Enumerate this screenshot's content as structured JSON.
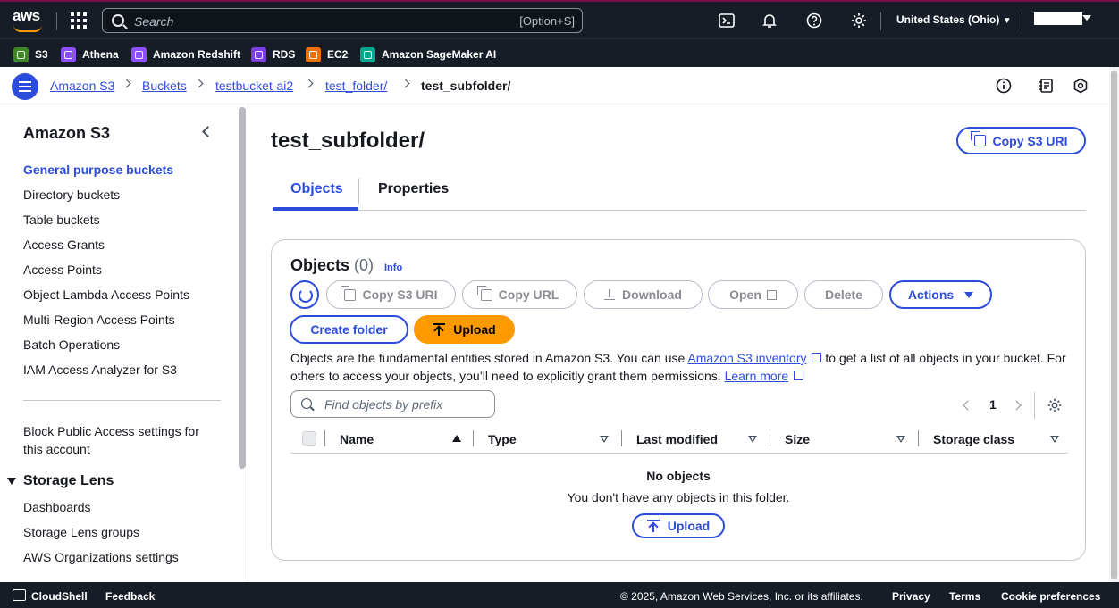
{
  "topnav": {
    "logo": "aws",
    "search_placeholder": "Search",
    "search_shortcut": "[Option+S]",
    "region": "United States (Ohio)",
    "icons": [
      "grid-icon",
      "cloudshell-icon",
      "bell-icon",
      "help-icon",
      "settings-icon"
    ]
  },
  "favorites": [
    {
      "label": "S3",
      "color": "#3f8624"
    },
    {
      "label": "Athena",
      "color": "#8c4fff"
    },
    {
      "label": "Amazon Redshift",
      "color": "#8c4fff"
    },
    {
      "label": "RDS",
      "color": "#7b3fe4"
    },
    {
      "label": "EC2",
      "color": "#ed7100"
    },
    {
      "label": "Amazon SageMaker AI",
      "color": "#01a88d"
    }
  ],
  "breadcrumb": {
    "items": [
      "Amazon S3",
      "Buckets",
      "testbucket-ai2",
      "test_folder/"
    ],
    "current": "test_subfolder/"
  },
  "sidebar": {
    "title": "Amazon S3",
    "items": [
      "General purpose buckets",
      "Directory buckets",
      "Table buckets",
      "Access Grants",
      "Access Points",
      "Object Lambda Access Points",
      "Multi-Region Access Points",
      "Batch Operations",
      "IAM Access Analyzer for S3"
    ],
    "block_line1": "Block Public Access settings for",
    "block_line2": "this account",
    "section": "Storage Lens",
    "section_items": [
      "Dashboards",
      "Storage Lens groups",
      "AWS Organizations settings"
    ]
  },
  "main": {
    "title": "test_subfolder/",
    "copy_uri_label": "Copy S3 URI",
    "tabs": [
      "Objects",
      "Properties"
    ]
  },
  "panel": {
    "title": "Objects",
    "count": "(0)",
    "info": "Info",
    "buttons": {
      "copy_uri": "Copy S3 URI",
      "copy_url": "Copy URL",
      "download": "Download",
      "open": "Open",
      "delete": "Delete",
      "actions": "Actions",
      "create_folder": "Create folder",
      "upload": "Upload"
    },
    "desc_part1": "Objects are the fundamental entities stored in Amazon S3. You can use ",
    "desc_link1": "Amazon S3 inventory",
    "desc_part2": " to get a list of all objects in your bucket. For others to access your objects, you’ll need to explicitly grant them permissions. ",
    "desc_link2": "Learn more",
    "filter_placeholder": "Find objects by prefix",
    "page": "1",
    "columns": [
      "Name",
      "Type",
      "Last modified",
      "Size",
      "Storage class"
    ],
    "empty_title": "No objects",
    "empty_sub": "You don't have any objects in this folder.",
    "empty_upload": "Upload"
  },
  "footer": {
    "cloudshell": "CloudShell",
    "feedback": "Feedback",
    "copyright": "© 2025, Amazon Web Services, Inc. or its affiliates.",
    "privacy": "Privacy",
    "terms": "Terms",
    "cookies": "Cookie preferences"
  }
}
